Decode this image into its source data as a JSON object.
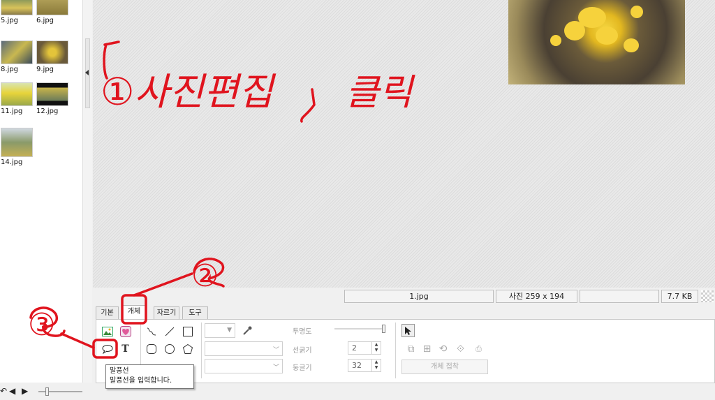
{
  "thumbnails": [
    {
      "label": "5.jpg"
    },
    {
      "label": "6.jpg"
    },
    {
      "label": "8.jpg"
    },
    {
      "label": "9.jpg"
    },
    {
      "label": "11.jpg"
    },
    {
      "label": "12.jpg"
    },
    {
      "label": "14.jpg"
    }
  ],
  "annotations": {
    "step1_text": "①사진편집",
    "step1_action": "클릭",
    "step2_marker": "②",
    "step3_marker": "③"
  },
  "status": {
    "filename": "1.jpg",
    "dimensions": "사진 259 x 194",
    "filesize": "7.7 KB"
  },
  "tabs": [
    {
      "label": "기본"
    },
    {
      "label": "개체",
      "active": true
    },
    {
      "label": "자르기"
    },
    {
      "label": "도구"
    }
  ],
  "panel": {
    "opacity_label": "투명도",
    "linewidth_label": "선굵기",
    "linewidth_value": "2",
    "roundness_label": "둥글기",
    "roundness_value": "32",
    "snap_button": "개체 접착"
  },
  "tooltip": {
    "title": "말풍선",
    "body": "말풍선을 입력합니다."
  },
  "colors": {
    "annotation_red": "#e0141e",
    "canvas_bg": "#e4e4e4",
    "panel_bg": "#ffffff"
  }
}
